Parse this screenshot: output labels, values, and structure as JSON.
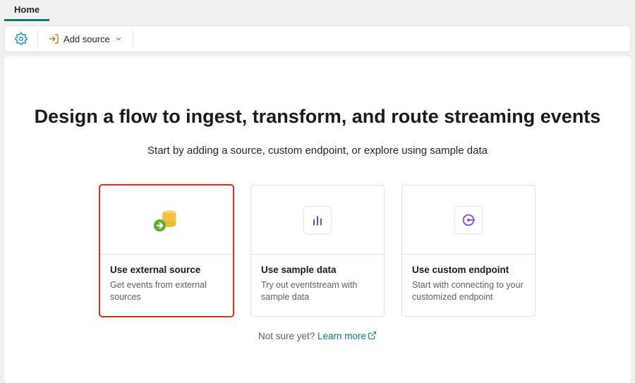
{
  "tab": {
    "label": "Home"
  },
  "toolbar": {
    "add_source_label": "Add source"
  },
  "hero": {
    "title": "Design a flow to ingest, transform, and route streaming events",
    "subtitle": "Start by adding a source, custom endpoint, or explore using sample data"
  },
  "options": [
    {
      "title": "Use external source",
      "desc": "Get events from external sources"
    },
    {
      "title": "Use sample data",
      "desc": "Try out eventstream with sample data"
    },
    {
      "title": "Use custom endpoint",
      "desc": "Start with connecting to your customized endpoint"
    }
  ],
  "footer": {
    "prompt": "Not sure yet? ",
    "link": "Learn more"
  }
}
